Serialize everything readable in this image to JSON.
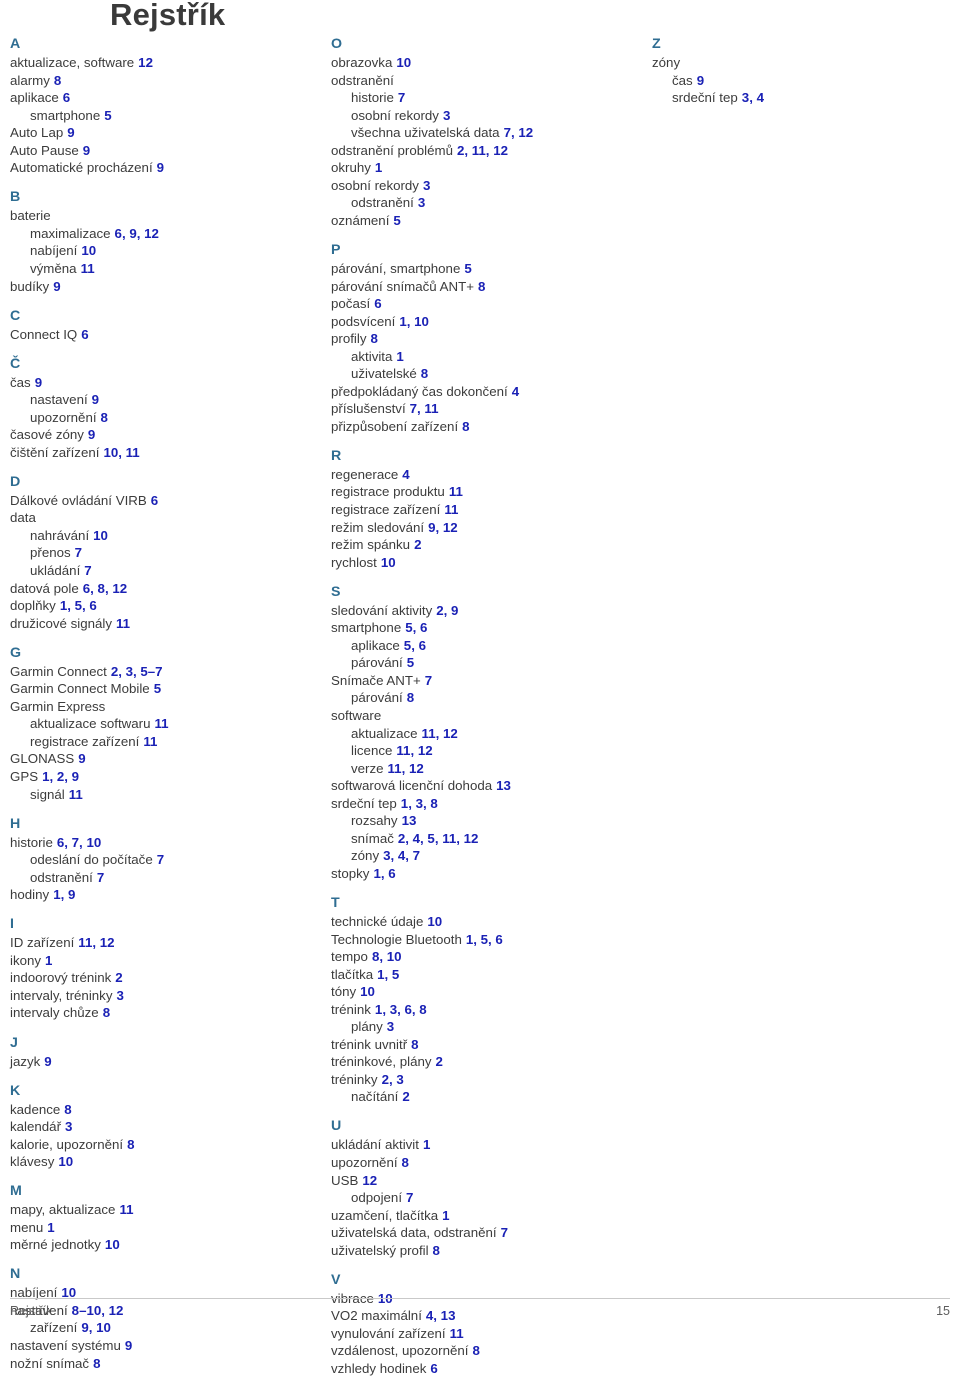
{
  "document": {
    "title": "Rejstřík",
    "footer": {
      "left": "Rejstřík",
      "right": "15"
    },
    "colors": {
      "letter_heading": "#2f6d92",
      "page_number": "#1a21b5",
      "body_text": "#3c3c3c",
      "title": "#3a3a3a"
    }
  },
  "columns": [
    {
      "id": "column-1",
      "groups": [
        {
          "letter": "A",
          "entries": [
            {
              "term": "aktualizace, software",
              "pages": "12",
              "sub": false
            },
            {
              "term": "alarmy",
              "pages": "8",
              "sub": false
            },
            {
              "term": "aplikace",
              "pages": "6",
              "sub": false
            },
            {
              "term": "smartphone",
              "pages": "5",
              "sub": true
            },
            {
              "term": "Auto Lap",
              "pages": "9",
              "sub": false
            },
            {
              "term": "Auto Pause",
              "pages": "9",
              "sub": false
            },
            {
              "term": "Automatické procházení",
              "pages": "9",
              "sub": false
            }
          ]
        },
        {
          "letter": "B",
          "entries": [
            {
              "term": "baterie",
              "pages": "",
              "sub": false
            },
            {
              "term": "maximalizace",
              "pages": "6, 9, 12",
              "sub": true
            },
            {
              "term": "nabíjení",
              "pages": "10",
              "sub": true
            },
            {
              "term": "výměna",
              "pages": "11",
              "sub": true
            },
            {
              "term": "budíky",
              "pages": "9",
              "sub": false
            }
          ]
        },
        {
          "letter": "C",
          "entries": [
            {
              "term": "Connect IQ",
              "pages": "6",
              "sub": false
            }
          ]
        },
        {
          "letter": "Č",
          "entries": [
            {
              "term": "čas",
              "pages": "9",
              "sub": false
            },
            {
              "term": "nastavení",
              "pages": "9",
              "sub": true
            },
            {
              "term": "upozornění",
              "pages": "8",
              "sub": true
            },
            {
              "term": "časové zóny",
              "pages": "9",
              "sub": false
            },
            {
              "term": "čištění zařízení",
              "pages": "10, 11",
              "sub": false
            }
          ]
        },
        {
          "letter": "D",
          "entries": [
            {
              "term": "Dálkové ovládání VIRB",
              "pages": "6",
              "sub": false
            },
            {
              "term": "data",
              "pages": "",
              "sub": false
            },
            {
              "term": "nahrávání",
              "pages": "10",
              "sub": true
            },
            {
              "term": "přenos",
              "pages": "7",
              "sub": true
            },
            {
              "term": "ukládání",
              "pages": "7",
              "sub": true
            },
            {
              "term": "datová pole",
              "pages": "6, 8, 12",
              "sub": false
            },
            {
              "term": "doplňky",
              "pages": "1, 5, 6",
              "sub": false
            },
            {
              "term": "družicové signály",
              "pages": "11",
              "sub": false
            }
          ]
        },
        {
          "letter": "G",
          "entries": [
            {
              "term": "Garmin Connect",
              "pages": "2, 3, 5–7",
              "sub": false
            },
            {
              "term": "Garmin Connect Mobile",
              "pages": "5",
              "sub": false
            },
            {
              "term": "Garmin Express",
              "pages": "",
              "sub": false
            },
            {
              "term": "aktualizace softwaru",
              "pages": "11",
              "sub": true
            },
            {
              "term": "registrace zařízení",
              "pages": "11",
              "sub": true
            },
            {
              "term": "GLONASS",
              "pages": "9",
              "sub": false
            },
            {
              "term": "GPS",
              "pages": "1, 2, 9",
              "sub": false
            },
            {
              "term": "signál",
              "pages": "11",
              "sub": true
            }
          ]
        },
        {
          "letter": "H",
          "entries": [
            {
              "term": "historie",
              "pages": "6, 7, 10",
              "sub": false
            },
            {
              "term": "odeslání do počítače",
              "pages": "7",
              "sub": true
            },
            {
              "term": "odstranění",
              "pages": "7",
              "sub": true
            },
            {
              "term": "hodiny",
              "pages": "1, 9",
              "sub": false
            }
          ]
        },
        {
          "letter": "I",
          "entries": [
            {
              "term": "ID zařízení",
              "pages": "11, 12",
              "sub": false
            },
            {
              "term": "ikony",
              "pages": "1",
              "sub": false
            },
            {
              "term": "indoorový trénink",
              "pages": "2",
              "sub": false
            },
            {
              "term": "intervaly, tréninky",
              "pages": "3",
              "sub": false
            },
            {
              "term": "intervaly chůze",
              "pages": "8",
              "sub": false
            }
          ]
        },
        {
          "letter": "J",
          "entries": [
            {
              "term": "jazyk",
              "pages": "9",
              "sub": false
            }
          ]
        },
        {
          "letter": "K",
          "entries": [
            {
              "term": "kadence",
              "pages": "8",
              "sub": false
            },
            {
              "term": "kalendář",
              "pages": "3",
              "sub": false
            },
            {
              "term": "kalorie, upozornění",
              "pages": "8",
              "sub": false
            },
            {
              "term": "klávesy",
              "pages": "10",
              "sub": false
            }
          ]
        },
        {
          "letter": "M",
          "entries": [
            {
              "term": "mapy, aktualizace",
              "pages": "11",
              "sub": false
            },
            {
              "term": "menu",
              "pages": "1",
              "sub": false
            },
            {
              "term": "měrné jednotky",
              "pages": "10",
              "sub": false
            }
          ]
        },
        {
          "letter": "N",
          "entries": [
            {
              "term": "nabíjení",
              "pages": "10",
              "sub": false
            },
            {
              "term": "nastavení",
              "pages": "8–10, 12",
              "sub": false
            },
            {
              "term": "zařízení",
              "pages": "9, 10",
              "sub": true
            },
            {
              "term": "nastavení systému",
              "pages": "9",
              "sub": false
            },
            {
              "term": "nožní snímač",
              "pages": "8",
              "sub": false
            }
          ]
        }
      ]
    },
    {
      "id": "column-2",
      "groups": [
        {
          "letter": "O",
          "entries": [
            {
              "term": "obrazovka",
              "pages": "10",
              "sub": false
            },
            {
              "term": "odstranění",
              "pages": "",
              "sub": false
            },
            {
              "term": "historie",
              "pages": "7",
              "sub": true
            },
            {
              "term": "osobní rekordy",
              "pages": "3",
              "sub": true
            },
            {
              "term": "všechna uživatelská data",
              "pages": "7, 12",
              "sub": true
            },
            {
              "term": "odstranění problémů",
              "pages": "2, 11, 12",
              "sub": false
            },
            {
              "term": "okruhy",
              "pages": "1",
              "sub": false
            },
            {
              "term": "osobní rekordy",
              "pages": "3",
              "sub": false
            },
            {
              "term": "odstranění",
              "pages": "3",
              "sub": true
            },
            {
              "term": "oznámení",
              "pages": "5",
              "sub": false
            }
          ]
        },
        {
          "letter": "P",
          "entries": [
            {
              "term": "párování, smartphone",
              "pages": "5",
              "sub": false
            },
            {
              "term": "párování snímačů ANT+",
              "pages": "8",
              "sub": false
            },
            {
              "term": "počasí",
              "pages": "6",
              "sub": false
            },
            {
              "term": "podsvícení",
              "pages": "1, 10",
              "sub": false
            },
            {
              "term": "profily",
              "pages": "8",
              "sub": false
            },
            {
              "term": "aktivita",
              "pages": "1",
              "sub": true
            },
            {
              "term": "uživatelské",
              "pages": "8",
              "sub": true
            },
            {
              "term": "předpokládaný čas dokončení",
              "pages": "4",
              "sub": false
            },
            {
              "term": "příslušenství",
              "pages": "7, 11",
              "sub": false
            },
            {
              "term": "přizpůsobení zařízení",
              "pages": "8",
              "sub": false
            }
          ]
        },
        {
          "letter": "R",
          "entries": [
            {
              "term": "regenerace",
              "pages": "4",
              "sub": false
            },
            {
              "term": "registrace produktu",
              "pages": "11",
              "sub": false
            },
            {
              "term": "registrace zařízení",
              "pages": "11",
              "sub": false
            },
            {
              "term": "režim sledování",
              "pages": "9, 12",
              "sub": false
            },
            {
              "term": "režim spánku",
              "pages": "2",
              "sub": false
            },
            {
              "term": "rychlost",
              "pages": "10",
              "sub": false
            }
          ]
        },
        {
          "letter": "S",
          "entries": [
            {
              "term": "sledování aktivity",
              "pages": "2, 9",
              "sub": false
            },
            {
              "term": "smartphone",
              "pages": "5, 6",
              "sub": false
            },
            {
              "term": "aplikace",
              "pages": "5, 6",
              "sub": true
            },
            {
              "term": "párování",
              "pages": "5",
              "sub": true
            },
            {
              "term": "Snímače ANT+",
              "pages": "7",
              "sub": false
            },
            {
              "term": "párování",
              "pages": "8",
              "sub": true
            },
            {
              "term": "software",
              "pages": "",
              "sub": false
            },
            {
              "term": "aktualizace",
              "pages": "11, 12",
              "sub": true
            },
            {
              "term": "licence",
              "pages": "11, 12",
              "sub": true
            },
            {
              "term": "verze",
              "pages": "11, 12",
              "sub": true
            },
            {
              "term": "softwarová licenční dohoda",
              "pages": "13",
              "sub": false
            },
            {
              "term": "srdeční tep",
              "pages": "1, 3, 8",
              "sub": false
            },
            {
              "term": "rozsahy",
              "pages": "13",
              "sub": true
            },
            {
              "term": "snímač",
              "pages": "2, 4, 5, 11, 12",
              "sub": true
            },
            {
              "term": "zóny",
              "pages": "3, 4, 7",
              "sub": true
            },
            {
              "term": "stopky",
              "pages": "1, 6",
              "sub": false
            }
          ]
        },
        {
          "letter": "T",
          "entries": [
            {
              "term": "technické údaje",
              "pages": "10",
              "sub": false
            },
            {
              "term": "Technologie Bluetooth",
              "pages": "1, 5, 6",
              "sub": false
            },
            {
              "term": "tempo",
              "pages": "8, 10",
              "sub": false
            },
            {
              "term": "tlačítka",
              "pages": "1, 5",
              "sub": false
            },
            {
              "term": "tóny",
              "pages": "10",
              "sub": false
            },
            {
              "term": "trénink",
              "pages": "1, 3, 6, 8",
              "sub": false
            },
            {
              "term": "plány",
              "pages": "3",
              "sub": true
            },
            {
              "term": "trénink uvnitř",
              "pages": "8",
              "sub": false
            },
            {
              "term": "tréninkové, plány",
              "pages": "2",
              "sub": false
            },
            {
              "term": "tréninky",
              "pages": "2, 3",
              "sub": false
            },
            {
              "term": "načítání",
              "pages": "2",
              "sub": true
            }
          ]
        },
        {
          "letter": "U",
          "entries": [
            {
              "term": "ukládání aktivit",
              "pages": "1",
              "sub": false
            },
            {
              "term": "upozornění",
              "pages": "8",
              "sub": false
            },
            {
              "term": "USB",
              "pages": "12",
              "sub": false
            },
            {
              "term": "odpojení",
              "pages": "7",
              "sub": true
            },
            {
              "term": "uzamčení, tlačítka",
              "pages": "1",
              "sub": false
            },
            {
              "term": "uživatelská data, odstranění",
              "pages": "7",
              "sub": false
            },
            {
              "term": "uživatelský profil",
              "pages": "8",
              "sub": false
            }
          ]
        },
        {
          "letter": "V",
          "entries": [
            {
              "term": "vibrace",
              "pages": "10",
              "sub": false
            },
            {
              "term": "VO2 maximální",
              "pages": "4, 13",
              "sub": false
            },
            {
              "term": "vynulování zařízení",
              "pages": "11",
              "sub": false
            },
            {
              "term": "vzdálenost, upozornění",
              "pages": "8",
              "sub": false
            },
            {
              "term": "vzhledy hodinek",
              "pages": "6",
              "sub": false
            }
          ]
        }
      ]
    },
    {
      "id": "column-3",
      "groups": [
        {
          "letter": "Z",
          "entries": [
            {
              "term": "zóny",
              "pages": "",
              "sub": false
            },
            {
              "term": "čas",
              "pages": "9",
              "sub": true
            },
            {
              "term": "srdeční tep",
              "pages": "3, 4",
              "sub": true
            }
          ]
        }
      ]
    }
  ]
}
